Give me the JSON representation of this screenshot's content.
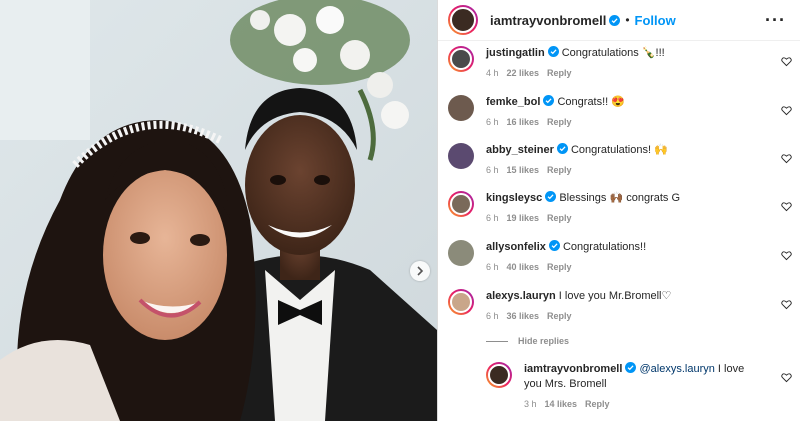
{
  "post": {
    "author": "iamtrayvonbromell",
    "follow_label": "Follow",
    "dot": "•"
  },
  "comments": [
    {
      "user": "justingatlin",
      "text": "Congratulations 🍾!!!",
      "time": "4 h",
      "likes": "22 likes",
      "reply": "Reply",
      "avatar_color": "#4a4a4a"
    },
    {
      "user": "femke_bol",
      "text": "Congrats!! 😍",
      "time": "6 h",
      "likes": "16 likes",
      "reply": "Reply",
      "avatar_color": "#6d5a4e"
    },
    {
      "user": "abby_steiner",
      "text": "Congratulations! 🙌",
      "time": "6 h",
      "likes": "15 likes",
      "reply": "Reply",
      "avatar_color": "#5b4a70"
    },
    {
      "user": "kingsleysc",
      "text": "Blessings 🙌🏾 congrats G",
      "time": "6 h",
      "likes": "19 likes",
      "reply": "Reply",
      "avatar_color": "#7a6a5a"
    },
    {
      "user": "allysonfelix",
      "text": "Congratulations!!",
      "time": "6 h",
      "likes": "40 likes",
      "reply": "Reply",
      "avatar_color": "#8b8b7a"
    },
    {
      "user": "alexys.lauryn",
      "text": "I love you Mr.Bromell♡",
      "time": "6 h",
      "likes": "36 likes",
      "reply": "Reply",
      "avatar_color": "#c9a68a"
    }
  ],
  "hide_replies": "Hide replies",
  "reply": {
    "user": "iamtrayvonbromell",
    "mention": "@alexys.lauryn",
    "text": " I love you Mrs. Bromell",
    "time": "3 h",
    "likes": "14 likes",
    "reply": "Reply"
  },
  "colors": {
    "accent": "#0095f6",
    "verified": "#0095f6",
    "muted": "#8e8e8e"
  },
  "icons": {
    "verified": "verified-badge-icon",
    "heart": "heart-icon",
    "more": "more-options-icon",
    "next": "chevron-right-icon"
  }
}
